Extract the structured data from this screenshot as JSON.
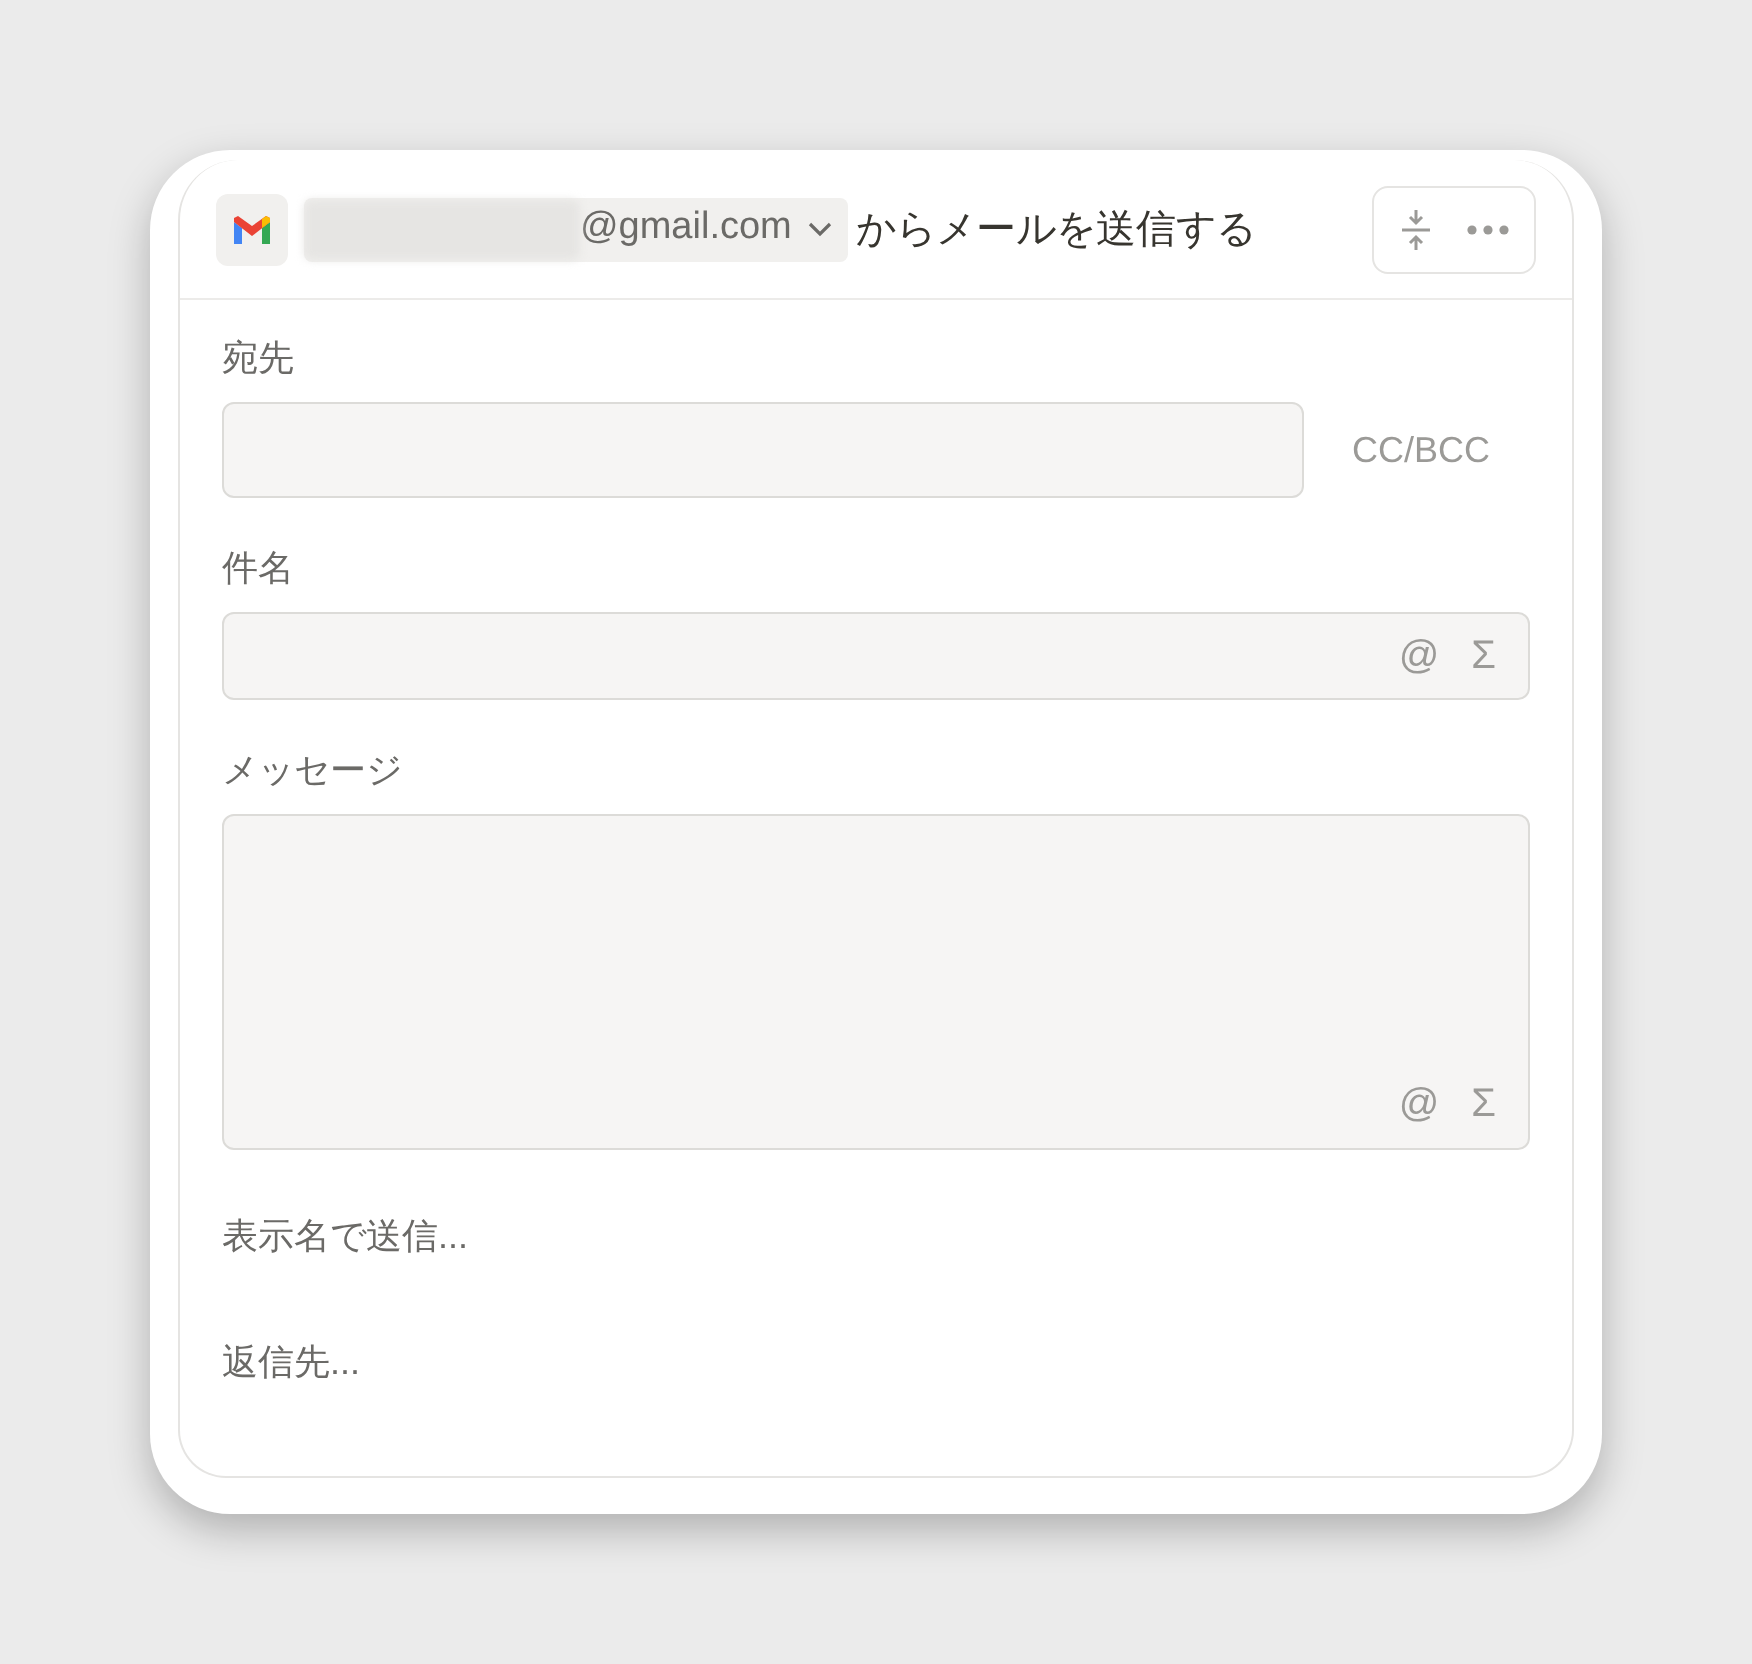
{
  "header": {
    "account": "@gmail.com",
    "action": "からメールを送信する"
  },
  "fields": [
    {
      "kind": "single",
      "label": "宛先",
      "side_link": "CC/BCC"
    },
    {
      "kind": "single",
      "label": "件名",
      "symbols": [
        "@",
        "Σ"
      ]
    },
    {
      "kind": "multi",
      "label": "メッセージ",
      "symbols": [
        "@",
        "Σ"
      ]
    }
  ],
  "links": [
    "表示名で送信...",
    "返信先..."
  ]
}
